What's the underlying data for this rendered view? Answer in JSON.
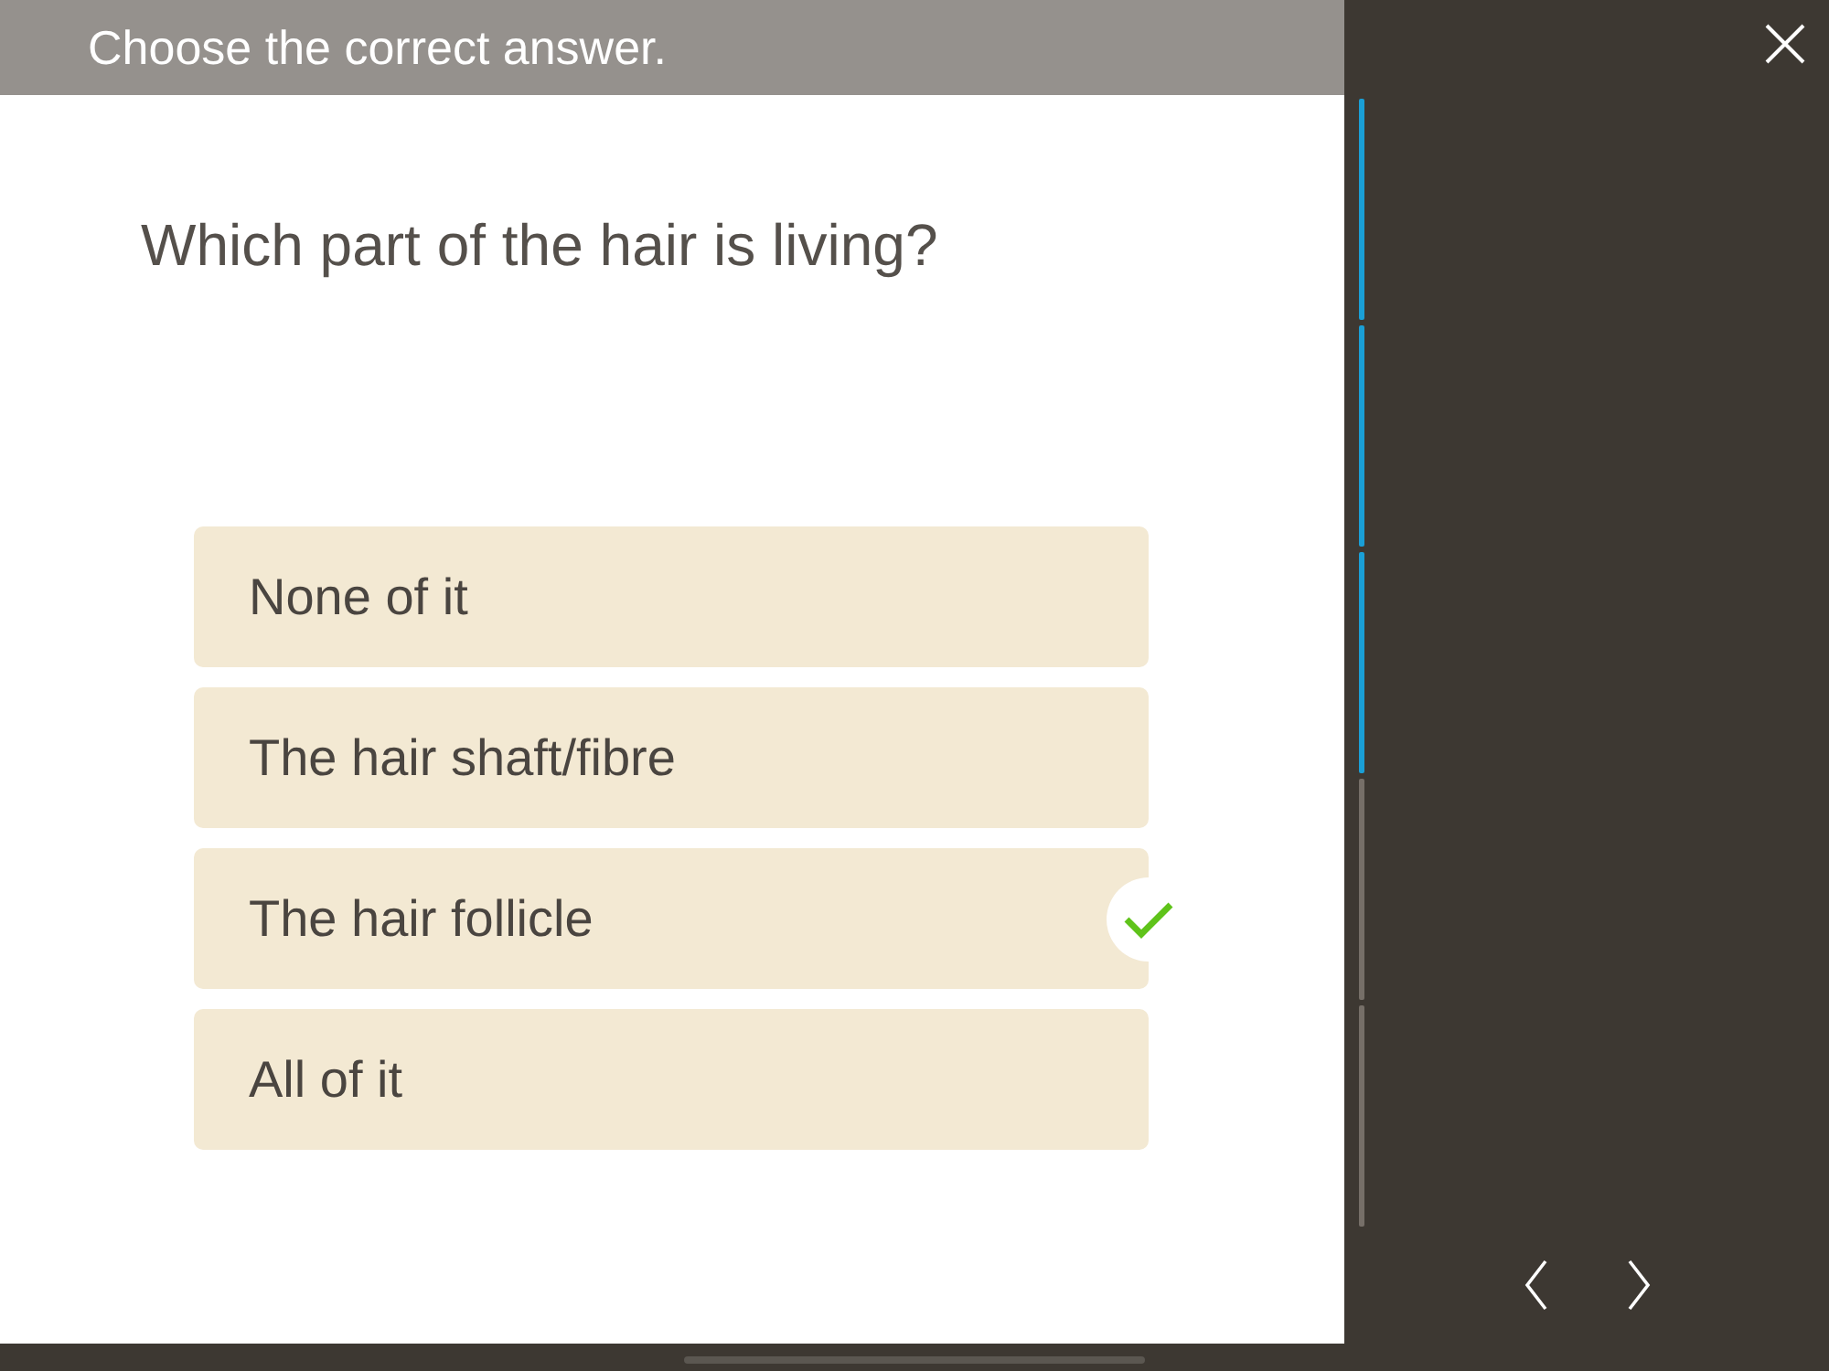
{
  "header": {
    "instruction": "Choose the correct answer."
  },
  "question": {
    "text": "Which part of the hair is living?"
  },
  "answers": [
    {
      "label": "None of it",
      "correct": false
    },
    {
      "label": "The hair shaft/fibre",
      "correct": false
    },
    {
      "label": "The hair follicle",
      "correct": true
    },
    {
      "label": "All of it",
      "correct": false
    }
  ],
  "progress": {
    "segments": [
      {
        "completed": true
      },
      {
        "completed": true
      },
      {
        "completed": true
      },
      {
        "completed": false
      },
      {
        "completed": false
      }
    ]
  }
}
